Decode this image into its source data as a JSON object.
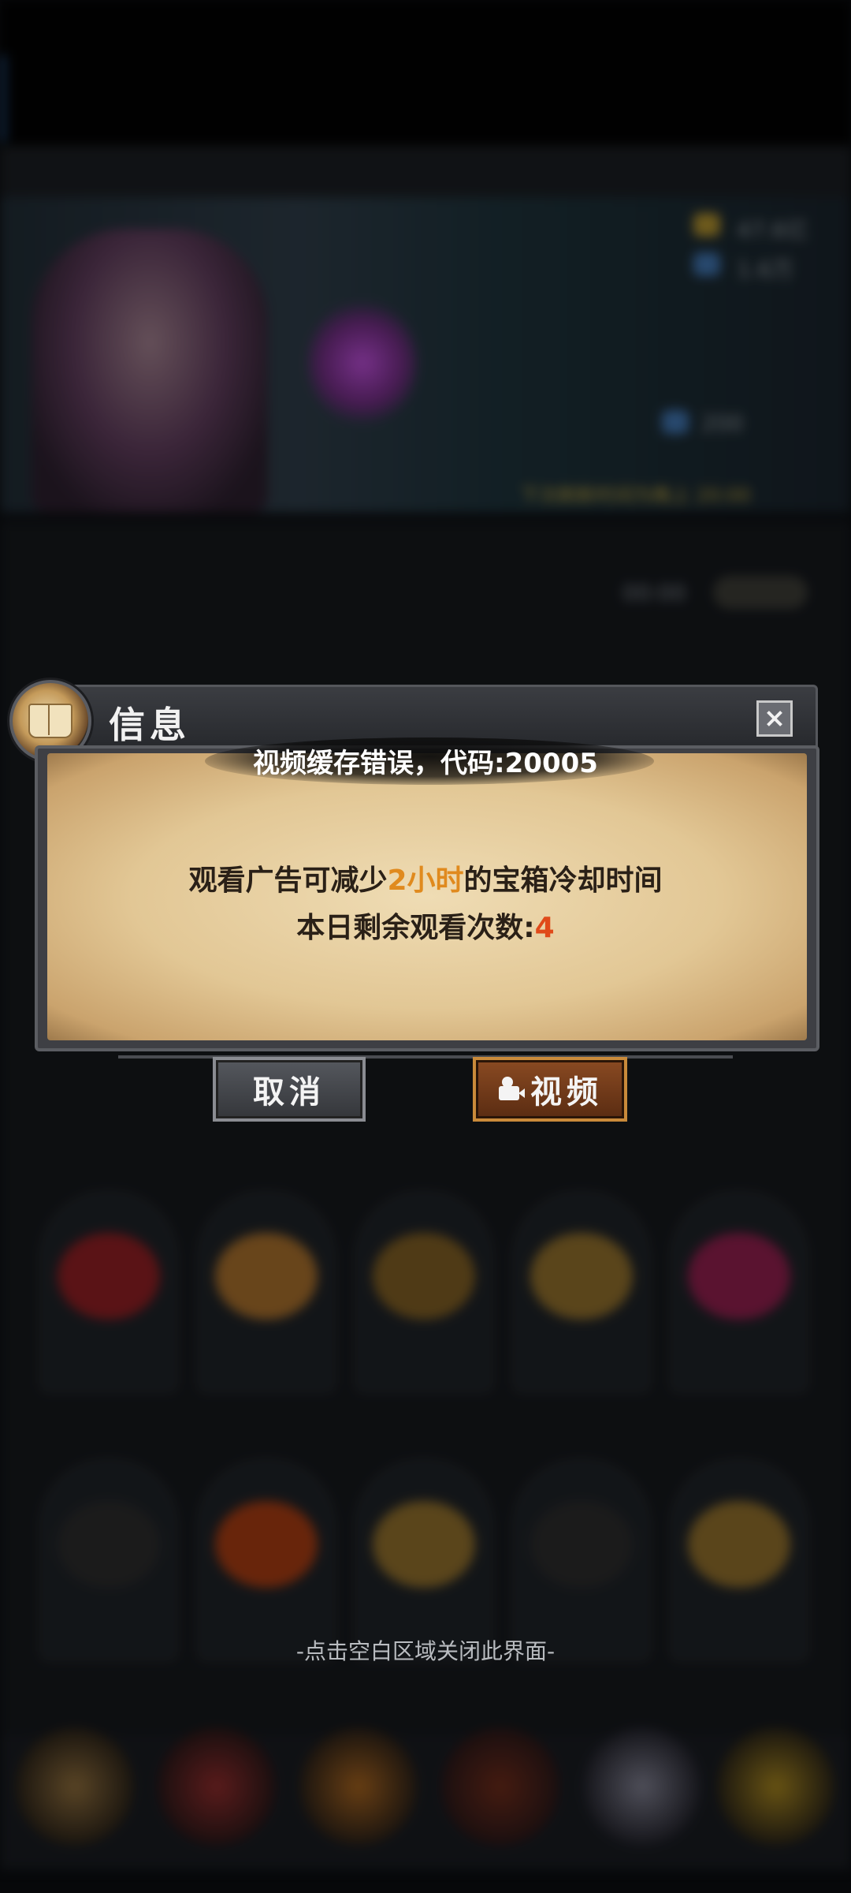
{
  "background": {
    "resources": [
      "47.6亿",
      "1.6万"
    ],
    "banner_footer": {
      "text": "下次刷新时间为晚上",
      "time": "20:00"
    },
    "cost_shown": "200",
    "timer": "00:00"
  },
  "dialog": {
    "title": "信息",
    "error_text": "视频缓存错误，代码:20005",
    "message_line1": {
      "prefix": "观看广告可减少",
      "highlight": "2小时",
      "suffix": "的宝箱冷却时间"
    },
    "message_line2": {
      "prefix": "本日剩余观看次数:",
      "count": "4"
    },
    "cancel_label": "取消",
    "video_label": "视频"
  },
  "hint": "-点击空白区域关闭此界面-",
  "colors": {
    "highlight_orange": "#e08a1e",
    "highlight_red": "#e04a1a",
    "parchment": "#e2c795"
  }
}
